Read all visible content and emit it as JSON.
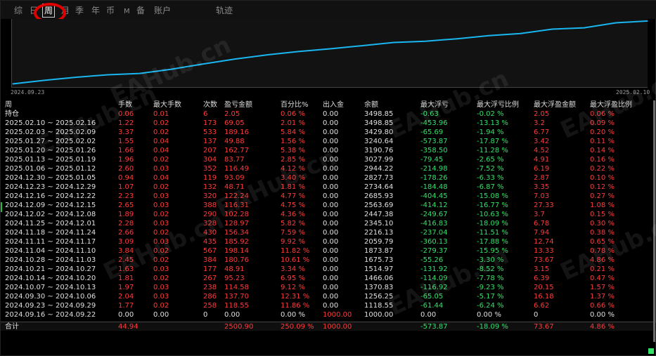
{
  "tabs": [
    {
      "label": "综",
      "active": false,
      "small": false
    },
    {
      "label": "日",
      "active": false,
      "small": false
    },
    {
      "label": "周",
      "active": true,
      "small": false
    },
    {
      "label": "月",
      "active": false,
      "small": false
    },
    {
      "label": "季",
      "active": false,
      "small": false
    },
    {
      "label": "年",
      "active": false,
      "small": false
    },
    {
      "label": "币",
      "active": false,
      "small": false
    },
    {
      "label": "M",
      "active": false,
      "small": true
    },
    {
      "label": "备",
      "active": false,
      "small": false
    },
    {
      "label": "账户",
      "active": false,
      "small": false
    },
    {
      "label": "轨迹",
      "active": false,
      "small": false
    }
  ],
  "chart": {
    "start_label": "2024.09.23",
    "end_label": "2025.02.10",
    "line_color": "#19b6f0",
    "grid": false
  },
  "chart_data": {
    "type": "line",
    "x": [
      "2024-09-23",
      "2024-09-30",
      "2024-10-07",
      "2024-10-14",
      "2024-10-21",
      "2024-10-28",
      "2024-11-04",
      "2024-11-11",
      "2024-11-18",
      "2024-11-25",
      "2024-12-02",
      "2024-12-09",
      "2024-12-16",
      "2024-12-23",
      "2024-12-30",
      "2025-01-06",
      "2025-01-13",
      "2025-01-20",
      "2025-01-27",
      "2025-02-03",
      "2025-02-10"
    ],
    "series": [
      {
        "values": [
          1118.55,
          1256.25,
          1370.83,
          1466.06,
          1514.97,
          1675.73,
          1873.87,
          2059.79,
          2216.13,
          2345.1,
          2447.38,
          2563.69,
          2685.93,
          2734.64,
          2827.73,
          2944.22,
          3027.99,
          3190.76,
          3240.64,
          3429.8,
          3498.85
        ]
      }
    ],
    "xlabel": "",
    "ylabel": ""
  },
  "table": {
    "headers": [
      "周",
      "手数",
      "最大手数",
      "次数",
      "盈亏金额",
      "百分比%",
      "出入金",
      "余额",
      "最大浮亏",
      "最大浮亏比例",
      "最大浮盈金额",
      "最大浮盈比例"
    ],
    "rows": [
      [
        "持仓",
        "0.06",
        "0.01",
        "6",
        "2.05",
        "0.06 %",
        "0.00",
        "3498.85",
        "-0.63",
        "-0.02 %",
        "2.05",
        "0.06 %"
      ],
      [
        "2025.02.10 ~ 2025.02.16",
        "1.22",
        "0.02",
        "173",
        "69.05",
        "2.01 %",
        "0.00",
        "3498.85",
        "-453.96",
        "-13.13 %",
        "3.2",
        "0.09 %"
      ],
      [
        "2025.02.03 ~ 2025.02.09",
        "3.37",
        "0.02",
        "533",
        "189.16",
        "5.84 %",
        "0.00",
        "3429.80",
        "-65.69",
        "-1.94 %",
        "6.77",
        "0.20 %"
      ],
      [
        "2025.01.27 ~ 2025.02.02",
        "1.55",
        "0.04",
        "137",
        "49.88",
        "1.56 %",
        "0.00",
        "3240.64",
        "-573.87",
        "-17.87 %",
        "3.42",
        "0.11 %"
      ],
      [
        "2025.01.20 ~ 2025.01.26",
        "1.66",
        "0.04",
        "207",
        "162.77",
        "5.38 %",
        "0.00",
        "3190.76",
        "-358.50",
        "-11.28 %",
        "4.52",
        "0.14 %"
      ],
      [
        "2025.01.13 ~ 2025.01.19",
        "1.96",
        "0.02",
        "304",
        "83.77",
        "2.85 %",
        "0.00",
        "3027.99",
        "-79.45",
        "-2.65 %",
        "4.91",
        "0.16 %"
      ],
      [
        "2025.01.06 ~ 2025.01.12",
        "2.60",
        "0.03",
        "352",
        "116.49",
        "4.12 %",
        "0.00",
        "2944.22",
        "-214.98",
        "-7.52 %",
        "6.19",
        "0.22 %"
      ],
      [
        "2024.12.30 ~ 2025.01.05",
        "0.94",
        "0.04",
        "119",
        "93.09",
        "3.40 %",
        "0.00",
        "2827.73",
        "-178.26",
        "-6.33 %",
        "2.87",
        "0.10 %"
      ],
      [
        "2024.12.23 ~ 2024.12.29",
        "1.07",
        "0.02",
        "132",
        "48.71",
        "1.81 %",
        "0.00",
        "2734.64",
        "-184.48",
        "-6.87 %",
        "3.35",
        "0.12 %"
      ],
      [
        "2024.12.16 ~ 2024.12.22",
        "2.23",
        "0.03",
        "320",
        "122.24",
        "4.77 %",
        "0.00",
        "2685.93",
        "-404.45",
        "-15.08 %",
        "7.03",
        "0.27 %"
      ],
      [
        "2024.12.09 ~ 2024.12.15",
        "2.65",
        "0.03",
        "388",
        "116.31",
        "4.75 %",
        "0.00",
        "2563.69",
        "-414.12",
        "-16.77 %",
        "27.33",
        "1.08 %"
      ],
      [
        "2024.12.02 ~ 2024.12.08",
        "1.89",
        "0.02",
        "290",
        "102.28",
        "4.36 %",
        "0.00",
        "2447.38",
        "-249.67",
        "-10.63 %",
        "3.7",
        "0.15 %"
      ],
      [
        "2024.11.25 ~ 2024.12.01",
        "2.28",
        "0.03",
        "328",
        "128.97",
        "5.82 %",
        "0.00",
        "2345.10",
        "-416.83",
        "-18.09 %",
        "6.78",
        "0.30 %"
      ],
      [
        "2024.11.18 ~ 2024.11.24",
        "2.66",
        "0.02",
        "430",
        "156.34",
        "7.59 %",
        "0.00",
        "2216.13",
        "-237.04",
        "-11.51 %",
        "7.94",
        "0.38 %"
      ],
      [
        "2024.11.11 ~ 2024.11.17",
        "3.09",
        "0.03",
        "435",
        "185.92",
        "9.92 %",
        "0.00",
        "2059.79",
        "-360.13",
        "-17.88 %",
        "12.74",
        "0.65 %"
      ],
      [
        "2024.11.04 ~ 2024.11.10",
        "3.84",
        "0.02",
        "567",
        "198.14",
        "11.82 %",
        "0.00",
        "1873.87",
        "-279.37",
        "-15.95 %",
        "13.33",
        "0.78 %"
      ],
      [
        "2024.10.28 ~ 2024.11.03",
        "2.45",
        "0.02",
        "384",
        "180.76",
        "10.61 %",
        "0.00",
        "1675.73",
        "-55.26",
        "-3.30 %",
        "73.67",
        "4.86 %"
      ],
      [
        "2024.10.21 ~ 2024.10.27",
        "1.63",
        "0.03",
        "177",
        "48.91",
        "3.34 %",
        "0.00",
        "1514.97",
        "-131.92",
        "-8.52 %",
        "3.15",
        "0.21 %"
      ],
      [
        "2024.10.14 ~ 2024.10.20",
        "1.81",
        "0.02",
        "267",
        "95.23",
        "6.95 %",
        "0.00",
        "1466.06",
        "-114.09",
        "-7.78 %",
        "6.39",
        "0.47 %"
      ],
      [
        "2024.10.07 ~ 2024.10.13",
        "1.97",
        "0.03",
        "238",
        "114.58",
        "9.12 %",
        "0.00",
        "1370.83",
        "-116.92",
        "-9.23 %",
        "20.15",
        "1.57 %"
      ],
      [
        "2024.09.30 ~ 2024.10.06",
        "2.04",
        "0.03",
        "286",
        "137.70",
        "12.31 %",
        "0.00",
        "1256.25",
        "-65.05",
        "-5.17 %",
        "16.18",
        "1.37 %"
      ],
      [
        "2024.09.23 ~ 2024.09.29",
        "1.77",
        "0.02",
        "258",
        "118.55",
        "11.86 %",
        "0.00",
        "1118.55",
        "-61.44",
        "-6.24 %",
        "6.62",
        "0.66 %"
      ],
      [
        "2024.09.16 ~ 2024.09.22",
        "0.00",
        "0.00",
        "0",
        "0.00",
        "0.00 %",
        "1000.00",
        "1000.00",
        "0.00",
        "0.00 %",
        "0",
        "0.00 %"
      ]
    ],
    "total": [
      "合计",
      "44.94",
      "",
      "",
      "2500.90",
      "250.09 %",
      "1000.00",
      "",
      "-573.87",
      "-18.09 %",
      "73.67",
      "4.86 %"
    ]
  },
  "watermark_text": "EAHub.cn",
  "colors": {
    "profit": "#ff3b3b",
    "loss": "#35e06a",
    "neutral": "#e0e0e0",
    "highlight": "#e00000"
  }
}
